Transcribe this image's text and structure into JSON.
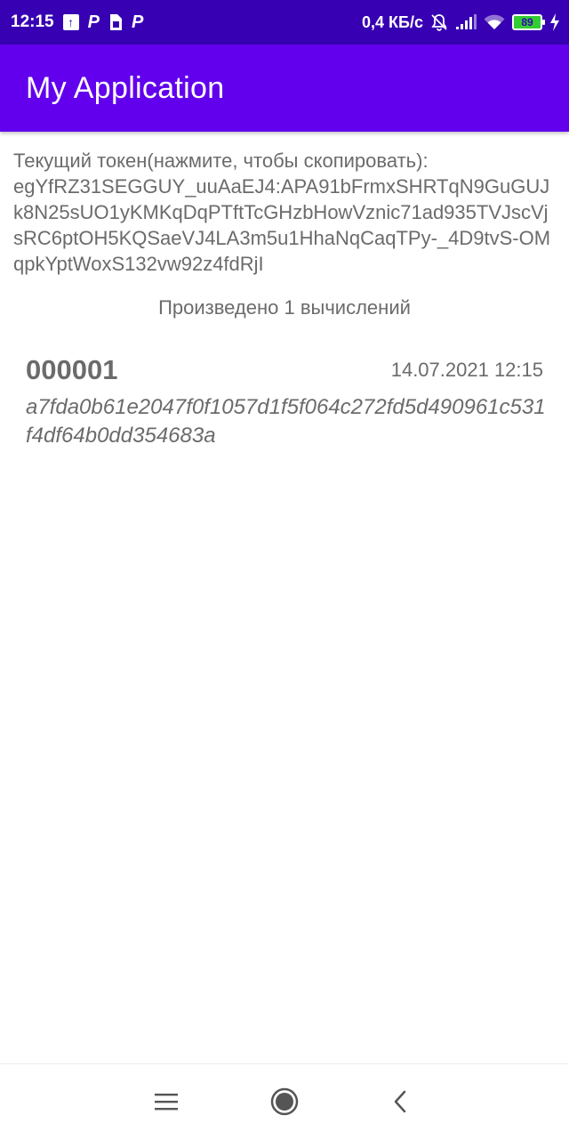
{
  "status_bar": {
    "time": "12:15",
    "left_icons": [
      "upload-icon",
      "parking-p-icon",
      "sim-card-icon",
      "parking-p-icon"
    ],
    "network_speed": "0,4 КБ/с",
    "battery_level": "89",
    "right_icons": [
      "bell-muted-icon",
      "signal-icon",
      "wifi-icon",
      "battery-icon",
      "charging-bolt-icon"
    ]
  },
  "app_bar": {
    "title": "My Application",
    "color": "#6200ee",
    "status_color": "#3700b3"
  },
  "main": {
    "token_label": "Текущий токен(нажмите, чтобы скопировать):",
    "token_value": "egYfRZ31SEGGUY_uuAaEJ4:APA91bFrmxSHRTqN9GuGUJk8N25sUO1yKMKqDqPTftTcGHzbHowVznic71ad935TVJscVjsRC6ptOH5KQSaeVJ4LA3m5u1HhaNqCaqTPy-_4D9tvS-OMqpkYptWoxS132vw92z4fdRjI",
    "count_text": "Произведено 1 вычислений",
    "calculations": [
      {
        "number": "000001",
        "date": "14.07.2021 12:15",
        "hash": "a7fda0b61e2047f0f1057d1f5f064c272fd5d490961c531f4df64b0dd354683a"
      }
    ]
  },
  "nav_bar": {
    "buttons": [
      "menu-icon",
      "home-icon",
      "back-icon"
    ]
  }
}
